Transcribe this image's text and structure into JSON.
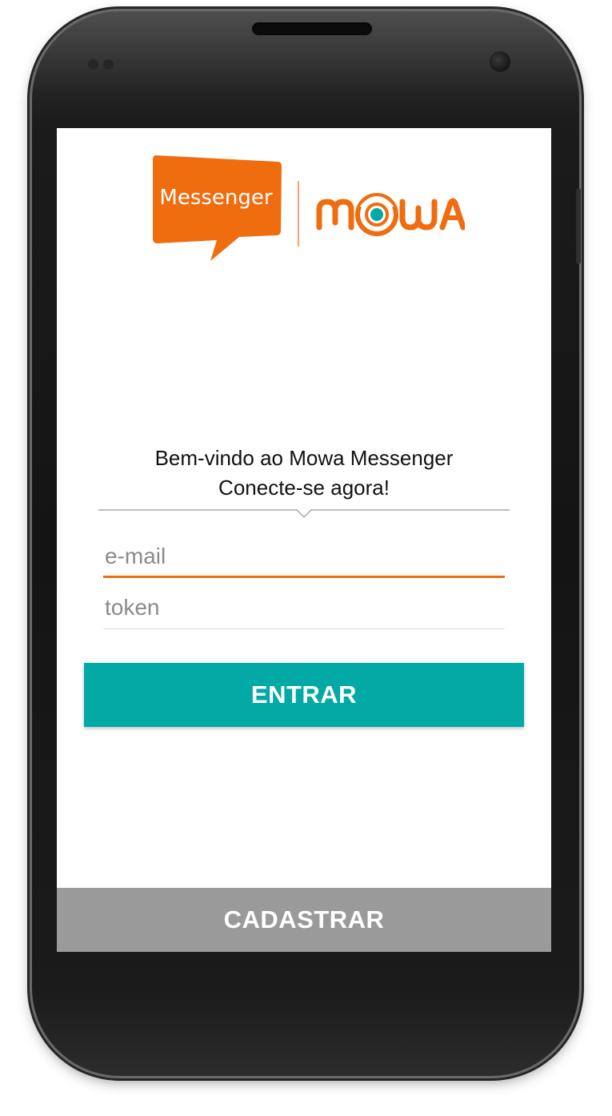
{
  "brand": {
    "messenger_text": "Messenger",
    "mowa_text": "mowa",
    "orange": "#ef6c0f",
    "teal": "#02a9a5"
  },
  "welcome": {
    "line1": "Bem-vindo ao Mowa Messenger",
    "line2": "Conecte-se agora!"
  },
  "form": {
    "email_placeholder": "e-mail",
    "token_placeholder": "token",
    "email_value": "",
    "token_value": ""
  },
  "actions": {
    "enter_label": "ENTRAR",
    "register_label": "CADASTRAR",
    "enter_color": "#02a9a5",
    "register_color": "#9a9a9a"
  }
}
